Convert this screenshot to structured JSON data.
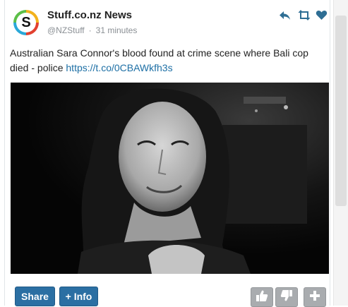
{
  "tweet": {
    "account_name": "Stuff.co.nz News",
    "handle": "@NZStuff",
    "separator": "·",
    "time": "31 minutes",
    "avatar_letter": "S",
    "text_before": "Australian Sara Connor's blood found at crime scene where Bali cop died - police ",
    "link": "https://t.co/0CBAWkfh3s",
    "icons": {
      "reply": "reply-icon",
      "retweet": "retweet-icon",
      "like": "heart-icon"
    },
    "accent_color": "#1d6fa5"
  },
  "toolbar": {
    "share_label": "Share",
    "info_label": "+ Info",
    "thumbs_up_icon": "thumbs-up-icon",
    "thumbs_down_icon": "thumbs-down-icon",
    "add_icon": "plus-icon"
  }
}
